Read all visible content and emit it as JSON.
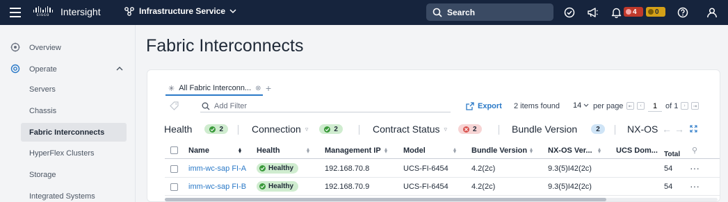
{
  "topbar": {
    "brand": "cisco",
    "app_title": "Intersight",
    "service": "Infrastructure Service",
    "search_placeholder": "Search",
    "alerts_critical": "4",
    "alerts_warning": "0"
  },
  "sidebar": {
    "items": [
      {
        "label": "Overview"
      },
      {
        "label": "Operate"
      },
      {
        "label": "Servers"
      },
      {
        "label": "Chassis"
      },
      {
        "label": "Fabric Interconnects"
      },
      {
        "label": "HyperFlex Clusters"
      },
      {
        "label": "Storage"
      },
      {
        "label": "Integrated Systems"
      }
    ]
  },
  "page": {
    "title": "Fabric Interconnects"
  },
  "toolbar": {
    "tab_label": "All Fabric Interconn...",
    "filter_placeholder": "Add Filter",
    "export_label": "Export",
    "items_found": "2 items found",
    "per_page_value": "14",
    "per_page_label": "per page",
    "page_current": "1",
    "page_of": "of 1"
  },
  "summary": {
    "health_label": "Health",
    "health_count": "2",
    "connection_label": "Connection",
    "connection_count": "2",
    "contract_label": "Contract Status",
    "contract_count": "2",
    "bundle_label": "Bundle Version",
    "bundle_count": "2",
    "nxos_label": "NX-OS"
  },
  "table": {
    "columns": {
      "name": "Name",
      "health": "Health",
      "mgmt_ip": "Management IP",
      "model": "Model",
      "bundle": "Bundle Version",
      "nxos": "NX-OS Ver...",
      "ucs": "UCS Dom...",
      "total": "Total"
    },
    "rows": [
      {
        "name": "imm-wc-sap FI-A",
        "health": "Healthy",
        "mgmt_ip": "192.168.70.8",
        "model": "UCS-FI-6454",
        "bundle": "4.2(2c)",
        "nxos": "9.3(5)I42(2c)",
        "total": "54"
      },
      {
        "name": "imm-wc-sap FI-B",
        "health": "Healthy",
        "mgmt_ip": "192.168.70.9",
        "model": "UCS-FI-6454",
        "bundle": "4.2(2c)",
        "nxos": "9.3(5)I42(2c)",
        "total": "54"
      }
    ]
  },
  "colors": {
    "topbar_bg": "#16243d",
    "accent": "#2a79c7",
    "healthy": "#3b9a3b",
    "critical": "#c0392b",
    "warning": "#d4a017"
  }
}
